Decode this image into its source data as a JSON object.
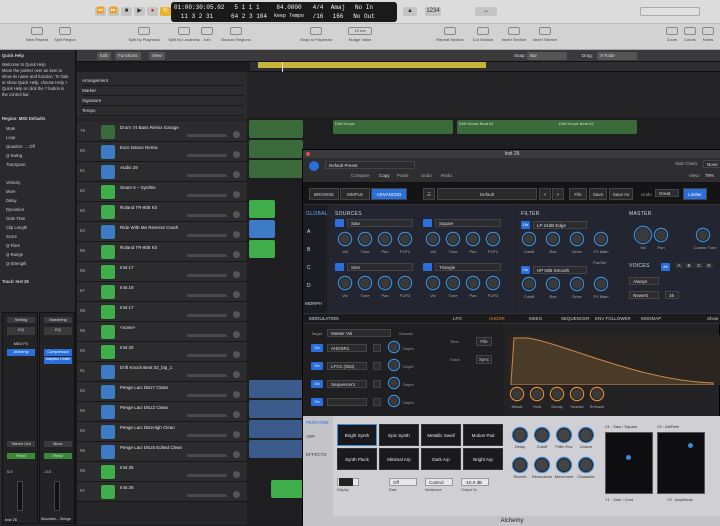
{
  "transport": {
    "bars": "01:00:30:05.02",
    "beats": "11 3 2 31",
    "pos1": "5 1 1 1",
    "pos2": "64 2 3 104",
    "tempo": "84.0000",
    "tempo_label": "Keep Tempo",
    "sig": "4/4",
    "div": "/16",
    "key": "Amaj",
    "key2": "166",
    "in": "No In",
    "out": "No Out"
  },
  "toolbar": {
    "left_tools": [
      "New Repeat",
      "Split Region"
    ],
    "mid_tools": [
      "Split by Playhead",
      "Split by Loudness",
      "Join",
      "Bounce Regions"
    ],
    "mid2": [
      "Snap to Playhead",
      "Nudge Value"
    ],
    "nudge": "10 ms",
    "right_tools": [
      "Repeat Section",
      "Cut Section",
      "Insert Section",
      "Insert Silence"
    ],
    "far_right": [
      "Zoom",
      "Colors",
      "Notes"
    ]
  },
  "menus": [
    "Edit",
    "Functions",
    "View"
  ],
  "snap": {
    "label": "Snap:",
    "value": "Bar",
    "drag_label": "Drag:",
    "drag_value": "X-Fade"
  },
  "inspector": {
    "quick_help_title": "Quick Help",
    "quick_help_text": [
      "Welcome to Quick Help",
      "Move the pointer over an item to",
      "show its name and function. To hide",
      "or show Quick Help, choose Help >",
      "Quick Help or click the ? button in",
      "the control bar."
    ],
    "region_title": "Region: MIDI Defaults",
    "params": [
      "Mute",
      "Loop",
      "Quantize  →  Off",
      "Q-Swing",
      "Transpose",
      "",
      "Velocity",
      "More",
      "Delay",
      "Dynamics",
      "Gate Time",
      "Clip Length",
      "Score",
      "Q-Flam",
      "Q-Range",
      "Q-Strength"
    ],
    "track_title": "Track: Inst 26",
    "strip1": {
      "settings": "Setting",
      "eq": "EQ",
      "midi": "MIDI FX",
      "inst": "Alchemy",
      "stereo": "Stereo Out",
      "read": "Read",
      "db": "0.0",
      "name": "Inst 26"
    },
    "strip2": {
      "settings": "Mastering",
      "eq": "EQ",
      "comp": "Compressor",
      "limiter": "Adaptive Limiter",
      "bnce": "Bnce",
      "read": "Read",
      "db": "-0.0",
      "name": "Mountain – Strings"
    }
  },
  "global_tracks": [
    "Arrangement",
    "Marker",
    "Signature",
    "Tempo"
  ],
  "tracks": [
    {
      "num": "79",
      "name": "Drum 74 Bass Remix Garage"
    },
    {
      "num": "80",
      "name": "Euro Dance Remix"
    },
    {
      "num": "81",
      "name": "Audio 29"
    },
    {
      "num": "82",
      "name": "Snare 5 – Synthie"
    },
    {
      "num": "83",
      "name": "Roland TR-808 Kit"
    },
    {
      "num": "84",
      "name": "Ride With Me Reverse Crash"
    },
    {
      "num": "85",
      "name": "Roland TR-808 Kit"
    },
    {
      "num": "86",
      "name": "Inst 17"
    },
    {
      "num": "87",
      "name": "Inst 19"
    },
    {
      "num": "88",
      "name": "Inst 17"
    },
    {
      "num": "89",
      "name": "<none>"
    },
    {
      "num": "90",
      "name": "Inst 20"
    },
    {
      "num": "91",
      "name": "Drift Knock Beat 02_bip_1"
    },
    {
      "num": "92",
      "name": "Penge Laci Disz7 Clean"
    },
    {
      "num": "93",
      "name": "Penge Laci Disz2 Clean"
    },
    {
      "num": "94",
      "name": "Penge Laci DiszHigh Clean"
    },
    {
      "num": "95",
      "name": "Penge Laci Disz5 Edited Clean"
    },
    {
      "num": "96",
      "name": "Inst 25"
    },
    {
      "num": "97",
      "name": "Inst 26"
    }
  ],
  "arrange_labels": [
    "Drift Knock",
    "Drift Knock Beat 02",
    "Drift Knock Beat 02"
  ],
  "plugin": {
    "title": "Inst 26",
    "preset": "Default Preset",
    "header_buttons": [
      "Compare",
      "Copy",
      "Paste",
      "Undo",
      "Redo"
    ],
    "side_chain": "Side Chain:",
    "side_chain_value": "None",
    "view_label": "View:",
    "view_value": "78%",
    "nav": [
      "BROWSE",
      "SIMPLE",
      "ADVANCED"
    ],
    "preset_center": "Default",
    "file_btns": [
      "File",
      "Save",
      "Save As"
    ],
    "undo_label": "Undo",
    "glide": "Great",
    "limiter": "Limiter",
    "global": "GLOBAL",
    "abcd": [
      "A",
      "B",
      "C",
      "D",
      "MORPH"
    ],
    "sources": "SOURCES",
    "osc_a": "Saw",
    "osc_b": "Square",
    "osc_c": "Sine",
    "osc_d": "Triangle",
    "src_knobs": [
      "Vol",
      "Tune",
      "Pan",
      "F1/F2"
    ],
    "filter": "FILTER",
    "filter1": "LP 24dB Edge",
    "filter2": "HP 6dB Smooth",
    "filt_knobs": [
      "Cutoff",
      "Res",
      "Drive",
      "FX Main"
    ],
    "parser": "Par/Ser",
    "master": "MASTER",
    "master_knobs": [
      "Vol",
      "Pan",
      "Coarse Tune"
    ],
    "voices": "VOICES",
    "voice_letters": [
      "All",
      "A",
      "B",
      "C",
      "D"
    ],
    "always": "Always",
    "newest": "Newest",
    "vnum": "16",
    "modulation": "MODULATION",
    "mod_tabs": [
      "LFO",
      "AHDSR",
      "MSEG",
      "SEQUENCER",
      "ENV FOLLOWER",
      "MODMAP"
    ],
    "show": "Show",
    "target_label": "Target",
    "target": "Master Vol",
    "smooth": "Smooth",
    "mods": [
      {
        "on": "On",
        "name": "AHDSR1",
        "lab": "Depth"
      },
      {
        "on": "On",
        "name": "LFO1 (Slot)",
        "lab": "Depth"
      },
      {
        "on": "On",
        "name": "Sequencer1",
        "lab": "Depth"
      },
      {
        "on": "On",
        "name": "",
        "lab": "Depth"
      }
    ],
    "trig": "Voice",
    "time_label": "Time",
    "sync": "Sync",
    "env_knobs": [
      "Attack",
      "Hold",
      "Decay",
      "Sustain",
      "Release"
    ],
    "perform": "PERFORM",
    "arp": "ARP",
    "effects": "EFFECTS",
    "pads": [
      "Bright Synth",
      "Epic Synth",
      "Metallic Swell",
      "Motion Pad",
      "Synth Pluck",
      "Minimal Arp",
      "Dark Arp",
      "Bright Arp"
    ],
    "perf_knobs": [
      "Delay",
      "Cutoff",
      "Filter Env",
      "Unison",
      "Reverb",
      "Resonance",
      "Movement",
      "Character"
    ],
    "xy1": "X1 : Saw / Square",
    "xy1b": "Y1 : Sine / Cont",
    "xy2": "X2 : Att/Rele",
    "xy2b": "Y2 : Amplitude",
    "bottom": [
      "Off",
      "Off",
      "Control",
      "-15.0 dB"
    ],
    "bottom_labels": [
      "Display",
      "Rate",
      "Multiprese",
      "Output Vo"
    ],
    "footer": "Alchemy"
  },
  "colors": {
    "accent": "#3a8bd8",
    "green": "#3fae4a",
    "cycle": "#c9b43a",
    "env": "#c9884a"
  }
}
